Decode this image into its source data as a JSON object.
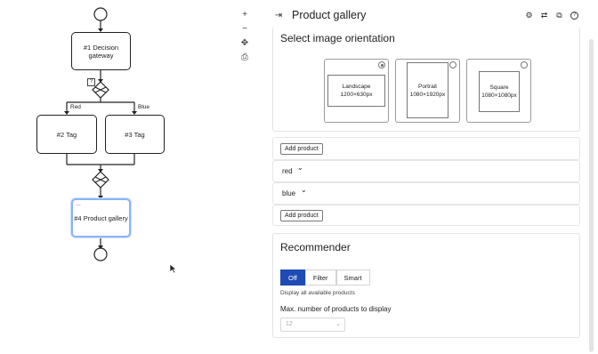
{
  "flow": {
    "decision_label": "#1 Decision gateway",
    "edge_red": "Red",
    "edge_blue": "Blue",
    "tag2_label": "#2 Tag",
    "tag3_label": "#3 Tag",
    "gallery_label": "#4 Product gallery",
    "gallery_dots": "...",
    "help_mark": "?"
  },
  "canvas_tools": {
    "zoom_in": "+",
    "zoom_out": "−",
    "fit": "✥",
    "print": "⎙"
  },
  "panel": {
    "collapse_icon": "⇥",
    "title": "Product gallery",
    "header_icons": [
      "gear-icon",
      "sliders-icon",
      "copy-icon",
      "help-icon"
    ],
    "header_glyphs": [
      "⚙",
      "⇄",
      "⧉",
      "?"
    ]
  },
  "orientation": {
    "title": "Select image orientation",
    "options": [
      {
        "name": "Landscape",
        "size": "1200×630px",
        "selected": true
      },
      {
        "name": "Portrait",
        "size": "1080×1920px",
        "selected": false
      },
      {
        "name": "Square",
        "size": "1080×1080px",
        "selected": false
      }
    ]
  },
  "products": {
    "add_label_1": "Add product",
    "tag_red": "red",
    "tag_blue": "blue",
    "add_label_2": "Add product",
    "chevron": "⌄"
  },
  "recommender": {
    "title": "Recommender",
    "modes": [
      "Off",
      "Filter",
      "Smart"
    ],
    "active_mode": "Off",
    "hint": "Display all available products",
    "max_label": "Max. number of products to display",
    "max_value": "12"
  }
}
